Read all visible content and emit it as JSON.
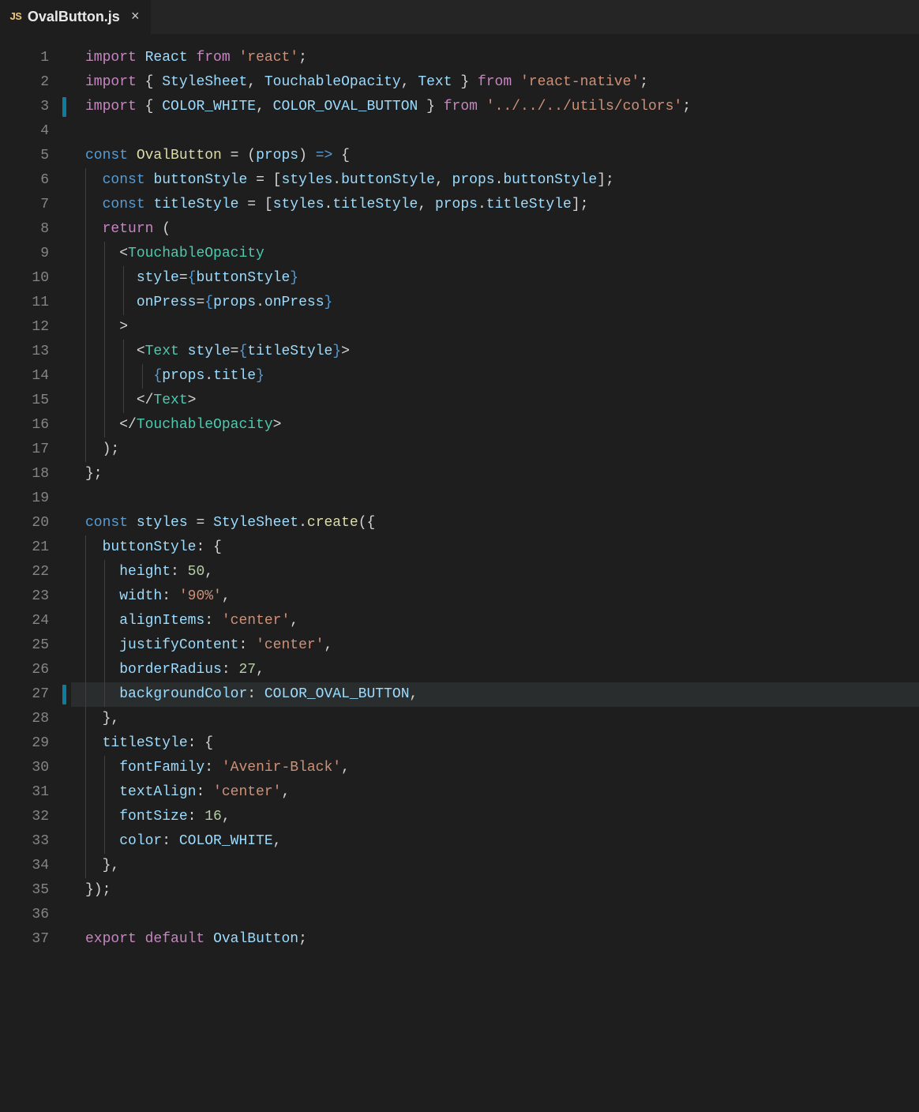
{
  "tab": {
    "icon_label": "JS",
    "title": "OvalButton.js",
    "close_glyph": "×"
  },
  "gutter": {
    "lines": [
      "1",
      "2",
      "3",
      "4",
      "5",
      "6",
      "7",
      "8",
      "9",
      "10",
      "11",
      "12",
      "13",
      "14",
      "15",
      "16",
      "17",
      "18",
      "19",
      "20",
      "21",
      "22",
      "23",
      "24",
      "25",
      "26",
      "27",
      "28",
      "29",
      "30",
      "31",
      "32",
      "33",
      "34",
      "35",
      "36",
      "37"
    ],
    "modified_lines": [
      3,
      27
    ],
    "current_line": 27
  },
  "tokens": {
    "import": "import",
    "from": "from",
    "const": "const",
    "return": "return",
    "export": "export",
    "default": "default",
    "React": "React",
    "react_str": "'react'",
    "StyleSheet": "StyleSheet",
    "TouchableOpacity": "TouchableOpacity",
    "Text": "Text",
    "react_native_str": "'react-native'",
    "COLOR_WHITE": "COLOR_WHITE",
    "COLOR_OVAL_BUTTON": "COLOR_OVAL_BUTTON",
    "colors_path_str": "'../../../utils/colors'",
    "OvalButton": "OvalButton",
    "props": "props",
    "arrow": "=>",
    "buttonStyle": "buttonStyle",
    "titleStyle": "titleStyle",
    "styles": "styles",
    "style_attr": "style",
    "onPress_attr": "onPress",
    "onPress": "onPress",
    "title": "title",
    "create": "create",
    "height": "height",
    "n50": "50",
    "width": "width",
    "s90": "'90%'",
    "alignItems": "alignItems",
    "center_str": "'center'",
    "justifyContent": "justifyContent",
    "borderRadius": "borderRadius",
    "n27": "27",
    "backgroundColor": "backgroundColor",
    "fontFamily": "fontFamily",
    "avenir_str": "'Avenir-Black'",
    "textAlign": "textAlign",
    "fontSize": "fontSize",
    "n16": "16",
    "color": "color"
  }
}
